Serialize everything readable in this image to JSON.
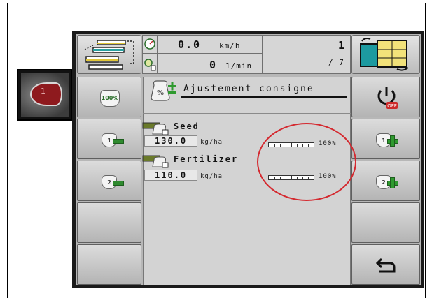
{
  "speed": {
    "value": "0.0",
    "unit": "km/h"
  },
  "rpm": {
    "value": "0",
    "unit": "1/min"
  },
  "page": {
    "current": "1",
    "total": "/ 7"
  },
  "sticker_label": "1",
  "panel": {
    "title": "Ajustement consigne"
  },
  "buttons": {
    "all_100_label": "100%",
    "product1_label": "1",
    "product2_label": "2"
  },
  "products": [
    {
      "name": "Seed",
      "rate": "130.0",
      "unit": "kg/ha",
      "percent_label": "100%",
      "percent": 100
    },
    {
      "name": "Fertilizer",
      "rate": "110.0",
      "unit": "kg/ha",
      "percent_label": "100%",
      "percent": 100
    }
  ],
  "colors": {
    "highlight_oval": "#d4292f",
    "off_badge": "#cc2a2a",
    "plus_minus": "#2f9a2f"
  }
}
